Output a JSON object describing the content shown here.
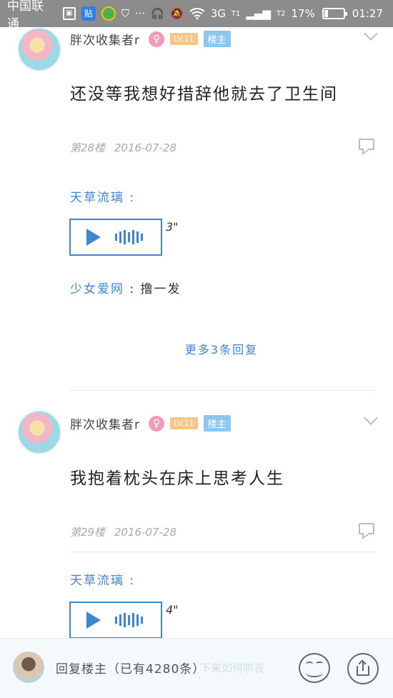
{
  "status_bar": {
    "carrier": "中国联通",
    "network": "3G",
    "signal_label": "T1",
    "sim2_label": "T2",
    "battery": "17%",
    "battery_level": 0.17,
    "time": "01:27"
  },
  "posts": [
    {
      "username": "胖次收集者r",
      "level": "LV.11",
      "owner_badge": "楼主",
      "text": "还没等我想好措辞他就去了卫生间",
      "floor": "第28楼",
      "date": "2016-07-28",
      "voice_reply_name": "天草流璃 :",
      "voice_duration": "3\"",
      "reply_name": "少女爱网",
      "reply_text": " : 撸一发",
      "more_replies": "更多3条回复"
    },
    {
      "username": "胖次收集者r",
      "level": "LV.11",
      "owner_badge": "楼主",
      "text": "我抱着枕头在床上思考人生",
      "floor": "第29楼",
      "date": "2016-07-28",
      "voice_reply_name": "天草流璃 :",
      "voice_duration": "4\""
    }
  ],
  "bottom_bar": {
    "reply_label": "回复楼主（已有4280条）",
    "ghost_text": "下来如何哄丧"
  },
  "colors": {
    "accent": "#3f86d2",
    "status_bar": "#8c8c8c",
    "level_badge": "#f7c48a",
    "owner_badge": "#8cc7ee",
    "gender_badge": "#f29bb6"
  },
  "icons": [
    "gallery-icon",
    "tieba-icon",
    "app-icon",
    "shield-icon",
    "more-icon",
    "headphone-icon",
    "mute-icon",
    "wifi-icon",
    "battery-icon",
    "female-icon",
    "chevron-down-icon",
    "comment-icon",
    "play-icon",
    "waveform-icon",
    "emoji-icon",
    "share-icon"
  ]
}
